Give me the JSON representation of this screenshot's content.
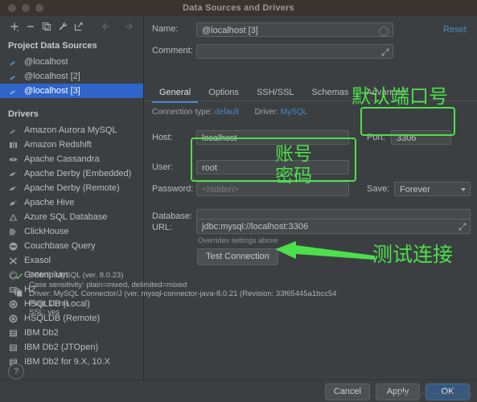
{
  "window": {
    "title": "Data Sources and Drivers"
  },
  "sidebar": {
    "toolbar": [
      {
        "name": "add-icon",
        "glyph": "+"
      },
      {
        "name": "remove-icon",
        "glyph": "−"
      },
      {
        "name": "copy-icon",
        "glyph": "copy"
      },
      {
        "name": "wrench-icon",
        "glyph": "wrench"
      },
      {
        "name": "import-icon",
        "glyph": "import"
      },
      {
        "name": "back-arrow-icon",
        "glyph": "←"
      },
      {
        "name": "forward-arrow-icon",
        "glyph": "→"
      }
    ],
    "project_group": "Project Data Sources",
    "data_sources": [
      {
        "label": "@localhost",
        "selected": false
      },
      {
        "label": "@localhost [2]",
        "selected": false
      },
      {
        "label": "@localhost [3]",
        "selected": true
      }
    ],
    "drivers_group": "Drivers",
    "drivers": [
      "Amazon Aurora MySQL",
      "Amazon Redshift",
      "Apache Cassandra",
      "Apache Derby (Embedded)",
      "Apache Derby (Remote)",
      "Apache Hive",
      "Azure SQL Database",
      "ClickHouse",
      "Couchbase Query",
      "Exasol",
      "Greenplum",
      "H2",
      "HSQLDB (Local)",
      "HSQLDB (Remote)",
      "IBM Db2",
      "IBM Db2 (JTOpen)",
      "IBM Db2 for 9.X, 10.X"
    ],
    "help_label": "?"
  },
  "form": {
    "name_label": "Name:",
    "name_value": "@localhost [3]",
    "comment_label": "Comment:",
    "comment_value": "",
    "reset_label": "Reset",
    "tabs": [
      {
        "label": "General",
        "active": true
      },
      {
        "label": "Options",
        "active": false
      },
      {
        "label": "SSH/SSL",
        "active": false
      },
      {
        "label": "Schemas",
        "active": false
      },
      {
        "label": "Advanced",
        "active": false
      }
    ],
    "connection_type_label": "Connection type:",
    "connection_type_value": "default",
    "driver_label": "Driver:",
    "driver_value": "MySQL",
    "host_label": "Host:",
    "host_value": "localhost",
    "port_label": "Port:",
    "port_value": "3306",
    "user_label": "User:",
    "user_value": "root",
    "password_label": "Password:",
    "password_placeholder": "<hidden>",
    "save_label": "Save:",
    "save_value": "Forever",
    "database_label": "Database:",
    "database_value": "",
    "url_label": "URL:",
    "url_value": "jdbc:mysql://localhost:3306",
    "url_hint": "Overrides settings above",
    "test_connection_label": "Test Connection"
  },
  "status": {
    "lines": [
      "DBMS: MySQL (ver. 8.0.23)",
      "Case sensitivity: plain=mixed, delimited=mixed",
      "Driver: MySQL Connector/J (ver. mysql-connector-java-8.0.21 (Revision: 33f65445a1bcc54",
      "Ping: 13 ms",
      "SSL: yes"
    ]
  },
  "footer": {
    "cancel_label": "Cancel",
    "apply_label": "Apply",
    "ok_label": "OK"
  },
  "annotations": {
    "color": "#4CE04C",
    "port_note": "默认端口号",
    "account_note": "账号",
    "password_note": "密码",
    "test_note": "测试连接"
  },
  "watermark": "https://blog.csdn.net/mbytes"
}
